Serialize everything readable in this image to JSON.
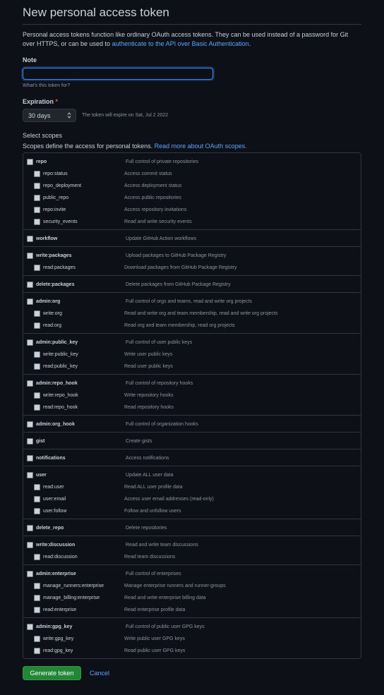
{
  "page": {
    "title": "New personal access token",
    "intro_text": "Personal access tokens function like ordinary OAuth access tokens. They can be used instead of a password for Git over HTTPS, or can be used to ",
    "intro_link": "authenticate to the API over Basic Authentication",
    "intro_end": "."
  },
  "note": {
    "label": "Note",
    "value": "",
    "placeholder": "",
    "hint": "What's this token for?"
  },
  "expiration": {
    "label": "Expiration",
    "required_mark": "*",
    "selected": "30 days",
    "note": "The token will expire on Sat, Jul 2 2022"
  },
  "scopes": {
    "heading": "Select scopes",
    "description": "Scopes define the access for personal tokens. ",
    "link": "Read more about OAuth scopes.",
    "groups": [
      {
        "name": "repo",
        "desc": "Full control of private repositories",
        "children": [
          {
            "name": "repo:status",
            "desc": "Access commit status"
          },
          {
            "name": "repo_deployment",
            "desc": "Access deployment status"
          },
          {
            "name": "public_repo",
            "desc": "Access public repositories"
          },
          {
            "name": "repo:invite",
            "desc": "Access repository invitations"
          },
          {
            "name": "security_events",
            "desc": "Read and write security events"
          }
        ]
      },
      {
        "name": "workflow",
        "desc": "Update GitHub Action workflows",
        "children": []
      },
      {
        "name": "write:packages",
        "desc": "Upload packages to GitHub Package Registry",
        "children": [
          {
            "name": "read:packages",
            "desc": "Download packages from GitHub Package Registry"
          }
        ]
      },
      {
        "name": "delete:packages",
        "desc": "Delete packages from GitHub Package Registry",
        "children": []
      },
      {
        "name": "admin:org",
        "desc": "Full control of orgs and teams, read and write org projects",
        "children": [
          {
            "name": "write:org",
            "desc": "Read and write org and team membership, read and write org projects"
          },
          {
            "name": "read:org",
            "desc": "Read org and team membership, read org projects"
          }
        ]
      },
      {
        "name": "admin:public_key",
        "desc": "Full control of user public keys",
        "children": [
          {
            "name": "write:public_key",
            "desc": "Write user public keys"
          },
          {
            "name": "read:public_key",
            "desc": "Read user public keys"
          }
        ]
      },
      {
        "name": "admin:repo_hook",
        "desc": "Full control of repository hooks",
        "children": [
          {
            "name": "write:repo_hook",
            "desc": "Write repository hooks"
          },
          {
            "name": "read:repo_hook",
            "desc": "Read repository hooks"
          }
        ]
      },
      {
        "name": "admin:org_hook",
        "desc": "Full control of organization hooks",
        "children": []
      },
      {
        "name": "gist",
        "desc": "Create gists",
        "children": []
      },
      {
        "name": "notifications",
        "desc": "Access notifications",
        "children": []
      },
      {
        "name": "user",
        "desc": "Update ALL user data",
        "children": [
          {
            "name": "read:user",
            "desc": "Read ALL user profile data"
          },
          {
            "name": "user:email",
            "desc": "Access user email addresses (read-only)"
          },
          {
            "name": "user:follow",
            "desc": "Follow and unfollow users"
          }
        ]
      },
      {
        "name": "delete_repo",
        "desc": "Delete repositories",
        "children": []
      },
      {
        "name": "write:discussion",
        "desc": "Read and write team discussions",
        "children": [
          {
            "name": "read:discussion",
            "desc": "Read team discussions"
          }
        ]
      },
      {
        "name": "admin:enterprise",
        "desc": "Full control of enterprises",
        "children": [
          {
            "name": "manage_runners:enterprise",
            "desc": "Manage enterprise runners and runner-groups"
          },
          {
            "name": "manage_billing:enterprise",
            "desc": "Read and write enterprise billing data"
          },
          {
            "name": "read:enterprise",
            "desc": "Read enterprise profile data"
          }
        ]
      },
      {
        "name": "admin:gpg_key",
        "desc": "Full control of public user GPG keys",
        "children": [
          {
            "name": "write:gpg_key",
            "desc": "Write public user GPG keys"
          },
          {
            "name": "read:gpg_key",
            "desc": "Read public user GPG keys"
          }
        ]
      }
    ]
  },
  "actions": {
    "generate_label": "Generate token",
    "cancel_label": "Cancel"
  }
}
